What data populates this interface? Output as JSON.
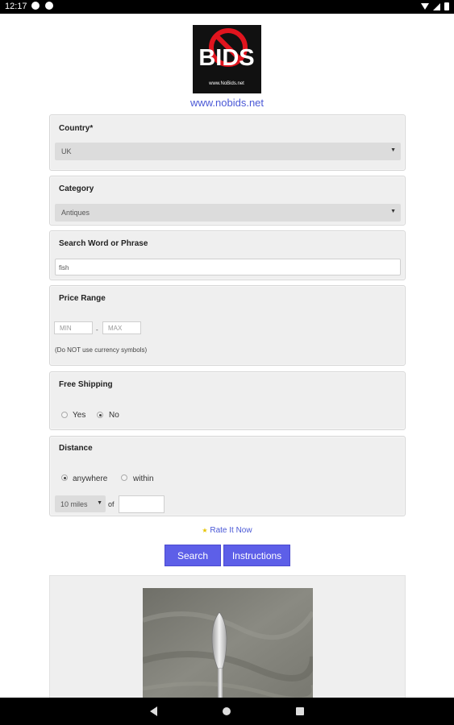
{
  "status_bar": {
    "time": "12:17"
  },
  "header": {
    "logo_text": "BIDS",
    "logo_caption": "www.NoBids.net",
    "site_link": "www.nobids.net"
  },
  "form": {
    "country": {
      "label": "Country*",
      "value": "UK"
    },
    "category": {
      "label": "Category",
      "value": "Antiques"
    },
    "search": {
      "label": "Search Word or Phrase",
      "value": "fish"
    },
    "price": {
      "label": "Price Range",
      "min_placeholder": "MIN",
      "separator": "-",
      "max_placeholder": "MAX",
      "hint": "(Do NOT use currency symbols)"
    },
    "shipping": {
      "label": "Free Shipping",
      "options": [
        "Yes",
        "No"
      ],
      "selected": "No"
    },
    "distance": {
      "label": "Distance",
      "options": [
        "anywhere",
        "within"
      ],
      "selected": "anywhere",
      "miles_value": "10 miles",
      "of_label": "of"
    }
  },
  "rate_link": "Rate It Now",
  "buttons": {
    "search": "Search",
    "instructions": "Instructions"
  },
  "colors": {
    "accent": "#5d5fe8",
    "link": "#4a58d6",
    "card_bg": "#efefef"
  }
}
